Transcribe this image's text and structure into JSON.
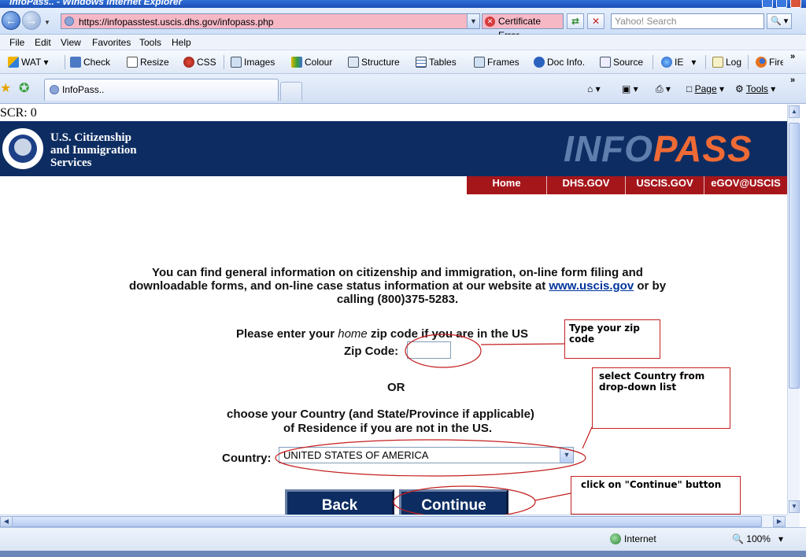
{
  "window": {
    "title": "InfoPass.. - Windows Internet Explorer"
  },
  "address": {
    "url": "https://infopasstest.uscis.dhs.gov/infopass.php",
    "cert_error": "Certificate Error",
    "search_placeholder": "Yahoo! Search"
  },
  "menu": [
    "File",
    "Edit",
    "View",
    "Favorites",
    "Tools",
    "Help"
  ],
  "wat_toolbar": [
    "WAT",
    "Check",
    "Resize",
    "CSS",
    "Images",
    "Colour",
    "Structure",
    "Tables",
    "Frames",
    "Doc Info.",
    "Source",
    "IE",
    "Log",
    "Fire"
  ],
  "tab": {
    "label": "InfoPass.."
  },
  "command_bar": {
    "page": "Page",
    "tools": "Tools"
  },
  "page": {
    "scr": "SCR: 0",
    "agency": {
      "line1": "U.S. Citizenship",
      "line2": "and Immigration",
      "line3": "Services"
    },
    "logo": {
      "info": "INFO",
      "pass": "PASS"
    },
    "nav": [
      "Home",
      "DHS.GOV",
      "USCIS.GOV",
      "eGOV@USCIS"
    ],
    "intro": {
      "line1": "You can find general information on citizenship and immigration, on-line form filing and",
      "line2_pre": "downloadable forms, and on-line case status information at our website at",
      "link": "www.uscis.gov",
      "line2_post": "or by",
      "line3": "calling (800)375-5283."
    },
    "zip": {
      "prompt_pre": "Please enter your",
      "prompt_em": "home",
      "prompt_post": "zip code if you are in the US",
      "label": "Zip Code:",
      "value": ""
    },
    "or": "OR",
    "choose": {
      "line1": "choose your Country (and State/Province if applicable)",
      "line2": "of Residence if you are not in the US."
    },
    "country": {
      "label": "Country:",
      "selected": "UNITED STATES OF AMERICA"
    },
    "buttons": {
      "back": "Back",
      "continue": "Continue"
    }
  },
  "annotations": {
    "zip": "Type your zip code",
    "country": "select Country from drop-down list",
    "continue": "click on \"Continue\" button"
  },
  "status": {
    "zone": "Internet",
    "zoom": "100%"
  },
  "colors": {
    "banner": "#0d2d62",
    "nav_red": "#a5161b",
    "annotation": "#c41f1f",
    "logo_pass": "#ef6a35",
    "logo_info": "#5f7eae"
  }
}
